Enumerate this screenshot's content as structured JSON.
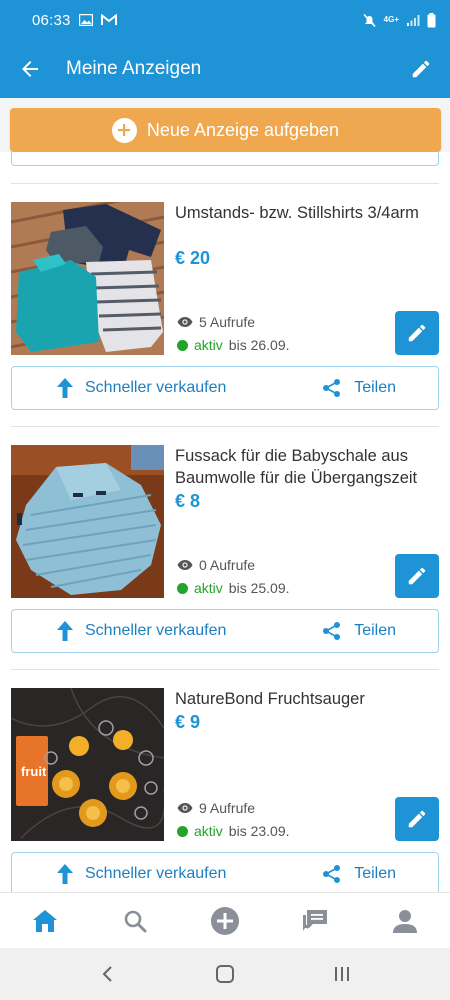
{
  "status_bar": {
    "time": "06:33",
    "network": "4G+"
  },
  "app_bar": {
    "title": "Meine Anzeigen"
  },
  "new_ad_button": {
    "label": "Neue Anzeige aufgeben"
  },
  "ads": [
    {
      "title": "Umstands- bzw. Stillshirts 3/4arm",
      "price": "€ 20",
      "views": "5 Aufrufe",
      "status": "aktiv",
      "until": "bis 26.09.",
      "sell_label": "Schneller verkaufen",
      "share_label": "Teilen"
    },
    {
      "title": "Fussack für die Babyschale aus Baumwolle für die Übergangszeit",
      "price": "€ 8",
      "views": "0 Aufrufe",
      "status": "aktiv",
      "until": "bis 25.09.",
      "sell_label": "Schneller verkaufen",
      "share_label": "Teilen"
    },
    {
      "title": "NatureBond Fruchtsauger",
      "price": "€ 9",
      "views": "9 Aufrufe",
      "status": "aktiv",
      "until": "bis 23.09.",
      "sell_label": "Schneller verkaufen",
      "share_label": "Teilen"
    }
  ],
  "product_labels": {
    "fruit_box": "fruit"
  },
  "bottom_nav": [
    {
      "name": "home",
      "icon": "home-icon",
      "active": true
    },
    {
      "name": "search",
      "icon": "search-icon",
      "active": false
    },
    {
      "name": "post",
      "icon": "add-circle-icon",
      "active": false
    },
    {
      "name": "messages",
      "icon": "chat-icon",
      "active": false
    },
    {
      "name": "profile",
      "icon": "person-icon",
      "active": false
    }
  ],
  "colors": {
    "primary": "#1e93d5",
    "accent_orange": "#f0a850",
    "active_green": "#23a32a"
  }
}
